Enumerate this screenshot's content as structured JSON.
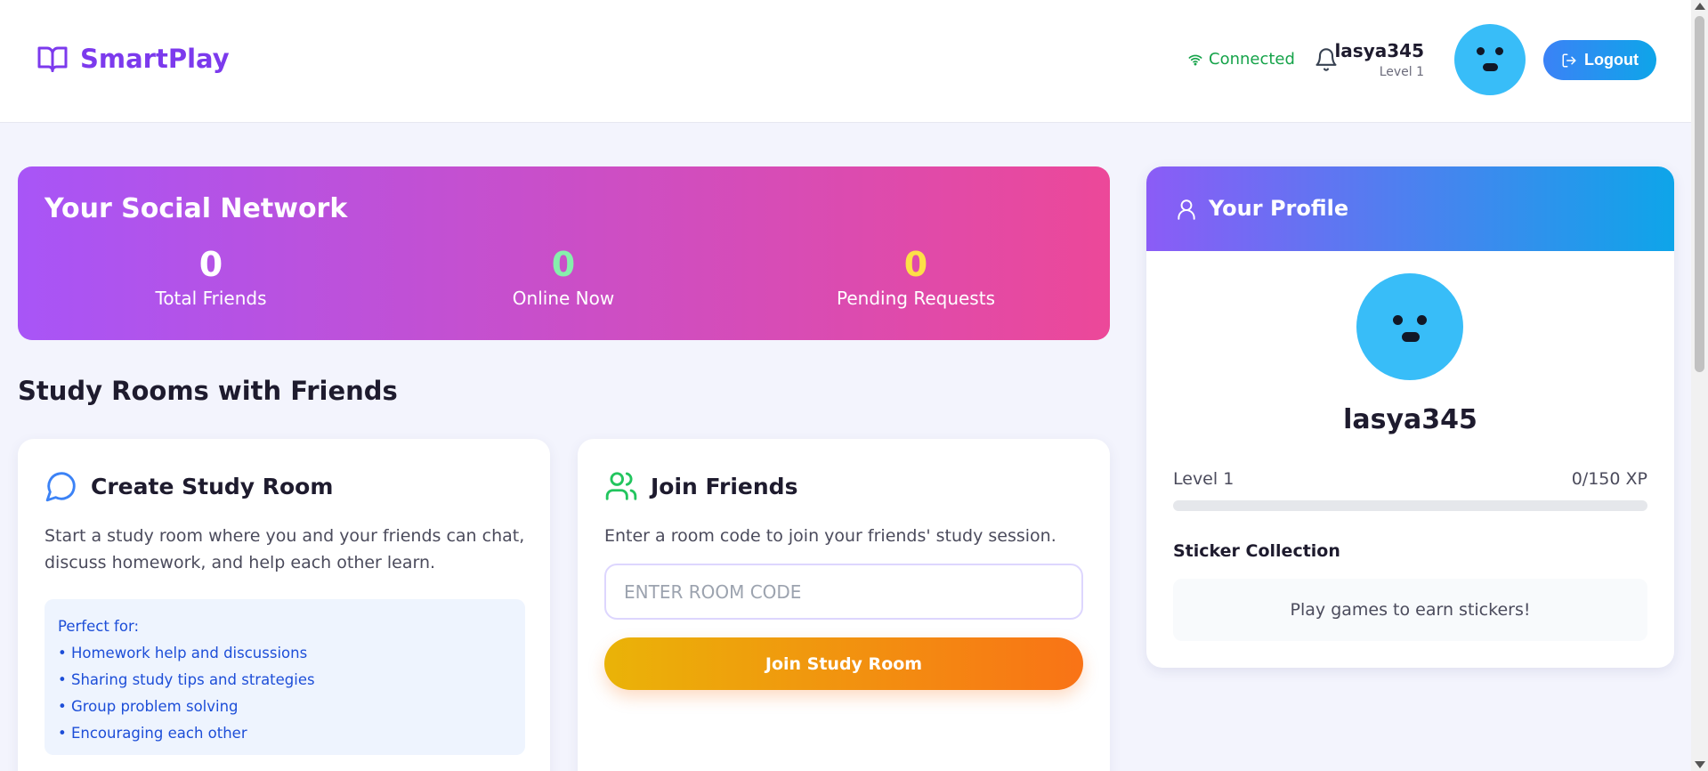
{
  "header": {
    "app_name": "SmartPlay",
    "connection_status": "Connected",
    "username": "lasya345",
    "level": "Level 1",
    "logout_label": "Logout"
  },
  "social": {
    "title": "Your Social Network",
    "stats": [
      {
        "value": "0",
        "label": "Total Friends",
        "color": "#ffffff"
      },
      {
        "value": "0",
        "label": "Online Now",
        "color": "#86efac"
      },
      {
        "value": "0",
        "label": "Pending Requests",
        "color": "#fde047"
      }
    ]
  },
  "study": {
    "section_title": "Study Rooms with Friends",
    "create": {
      "title": "Create Study Room",
      "description": "Start a study room where you and your friends can chat, discuss homework, and help each other learn.",
      "perfect_for_title": "Perfect for:",
      "items": [
        "• Homework help and discussions",
        "• Sharing study tips and strategies",
        "• Group problem solving",
        "• Encouraging each other"
      ]
    },
    "join": {
      "title": "Join Friends",
      "description": "Enter a room code to join your friends' study session.",
      "input_placeholder": "ENTER ROOM CODE",
      "input_value": "",
      "button_label": "Join Study Room"
    }
  },
  "profile": {
    "title": "Your Profile",
    "username": "lasya345",
    "level": "Level 1",
    "xp": "0/150 XP",
    "xp_progress": 0,
    "sticker_title": "Sticker Collection",
    "sticker_empty": "Play games to earn stickers!"
  },
  "colors": {
    "brand": "#7c3aed",
    "connected": "#16a34a",
    "avatar": "#38bdf8"
  },
  "icons": [
    "book-icon",
    "wifi-icon",
    "bell-icon",
    "logout-icon",
    "chat-bubble-icon",
    "users-icon",
    "user-icon"
  ]
}
